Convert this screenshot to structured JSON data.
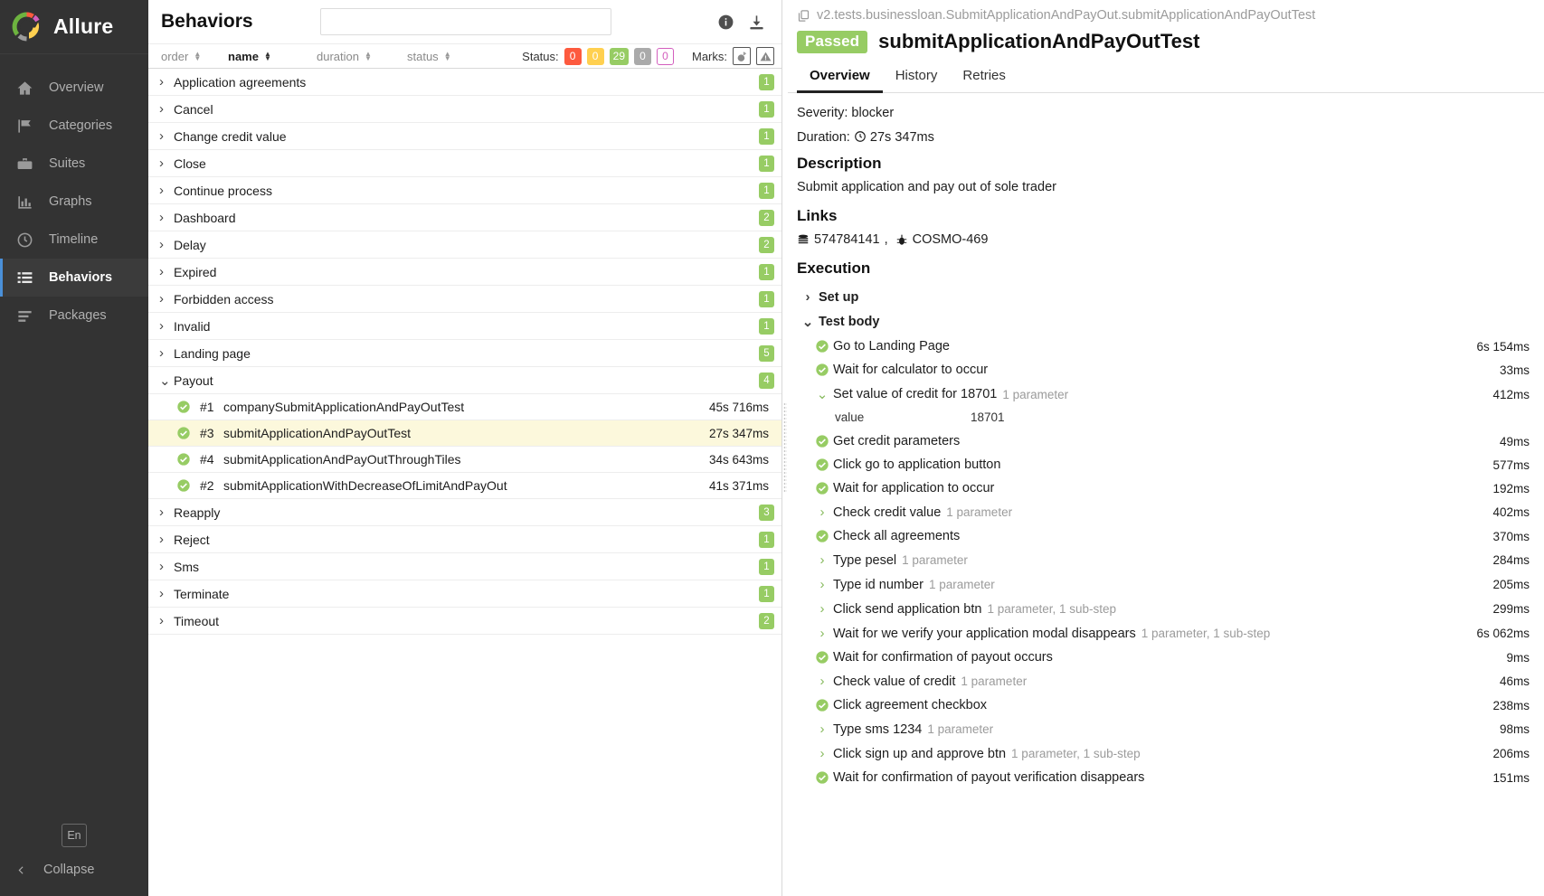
{
  "brand": {
    "name": "Allure",
    "logo_icon": "allure-logo-icon"
  },
  "sidebar": {
    "items": [
      {
        "label": "Overview",
        "icon": "home-icon",
        "active": false
      },
      {
        "label": "Categories",
        "icon": "flag-icon",
        "active": false
      },
      {
        "label": "Suites",
        "icon": "briefcase-icon",
        "active": false
      },
      {
        "label": "Graphs",
        "icon": "bar-chart-icon",
        "active": false
      },
      {
        "label": "Timeline",
        "icon": "clock-icon",
        "active": false
      },
      {
        "label": "Behaviors",
        "icon": "list-icon",
        "active": true
      },
      {
        "label": "Packages",
        "icon": "layers-icon",
        "active": false
      }
    ],
    "language_button": "En",
    "collapse_label": "Collapse",
    "collapse_icon": "chevron-left-icon"
  },
  "header": {
    "title": "Behaviors",
    "search_value": "",
    "search_placeholder": "",
    "info_icon": "info-icon",
    "download_icon": "download-icon"
  },
  "toolbar": {
    "columns": [
      {
        "label": "order",
        "active": false
      },
      {
        "label": "name",
        "active": true
      },
      {
        "label": "duration",
        "active": false
      },
      {
        "label": "status",
        "active": false
      }
    ],
    "status_label": "Status:",
    "status_counts": [
      {
        "key": "failed",
        "value": "0"
      },
      {
        "key": "broken",
        "value": "0"
      },
      {
        "key": "passed",
        "value": "29"
      },
      {
        "key": "skipped",
        "value": "0"
      },
      {
        "key": "unknown",
        "value": "0"
      }
    ],
    "marks_label": "Marks:",
    "marks": [
      {
        "icon": "bomb-icon"
      },
      {
        "icon": "warning-triangle-icon"
      }
    ]
  },
  "tree": {
    "rows": [
      {
        "type": "group",
        "label": "Application agreements",
        "expanded": false,
        "badge": "1"
      },
      {
        "type": "group",
        "label": "Cancel",
        "expanded": false,
        "badge": "1"
      },
      {
        "type": "group",
        "label": "Change credit value",
        "expanded": false,
        "badge": "1"
      },
      {
        "type": "group",
        "label": "Close",
        "expanded": false,
        "badge": "1"
      },
      {
        "type": "group",
        "label": "Continue process",
        "expanded": false,
        "badge": "1"
      },
      {
        "type": "group",
        "label": "Dashboard",
        "expanded": false,
        "badge": "2"
      },
      {
        "type": "group",
        "label": "Delay",
        "expanded": false,
        "badge": "2"
      },
      {
        "type": "group",
        "label": "Expired",
        "expanded": false,
        "badge": "1"
      },
      {
        "type": "group",
        "label": "Forbidden access",
        "expanded": false,
        "badge": "1"
      },
      {
        "type": "group",
        "label": "Invalid",
        "expanded": false,
        "badge": "1"
      },
      {
        "type": "group",
        "label": "Landing page",
        "expanded": false,
        "badge": "5"
      },
      {
        "type": "group",
        "label": "Payout",
        "expanded": true,
        "badge": "4"
      },
      {
        "type": "leaf",
        "num": "#1",
        "label": "companySubmitApplicationAndPayOutTest",
        "duration": "45s 716ms",
        "status": "passed",
        "active": false
      },
      {
        "type": "leaf",
        "num": "#3",
        "label": "submitApplicationAndPayOutTest",
        "duration": "27s 347ms",
        "status": "passed",
        "active": true
      },
      {
        "type": "leaf",
        "num": "#4",
        "label": "submitApplicationAndPayOutThroughTiles",
        "duration": "34s 643ms",
        "status": "passed",
        "active": false
      },
      {
        "type": "leaf",
        "num": "#2",
        "label": "submitApplicationWithDecreaseOfLimitAndPayOut",
        "duration": "41s 371ms",
        "status": "passed",
        "active": false
      },
      {
        "type": "group",
        "label": "Reapply",
        "expanded": false,
        "badge": "3"
      },
      {
        "type": "group",
        "label": "Reject",
        "expanded": false,
        "badge": "1"
      },
      {
        "type": "group",
        "label": "Sms",
        "expanded": false,
        "badge": "1"
      },
      {
        "type": "group",
        "label": "Terminate",
        "expanded": false,
        "badge": "1"
      },
      {
        "type": "group",
        "label": "Timeout",
        "expanded": false,
        "badge": "2"
      }
    ]
  },
  "detail": {
    "breadcrumb_icon": "copy-icon",
    "breadcrumb": "v2.tests.businessloan.SubmitApplicationAndPayOut.submitApplicationAndPayOutTest",
    "status_badge": "Passed",
    "title": "submitApplicationAndPayOutTest",
    "tabs": [
      {
        "label": "Overview",
        "active": true
      },
      {
        "label": "History",
        "active": false
      },
      {
        "label": "Retries",
        "active": false
      }
    ],
    "severity_line": "Severity: blocker",
    "duration_prefix": "Duration:",
    "duration_icon": "clock-icon",
    "duration_value": "27s 347ms",
    "description_heading": "Description",
    "description_text": "Submit application and pay out of sole trader",
    "links_heading": "Links",
    "links": [
      {
        "icon": "database-icon",
        "label": "574784141"
      },
      {
        "icon": "bug-icon",
        "label": "COSMO-469"
      }
    ],
    "links_separator": ",",
    "execution_heading": "Execution",
    "execution": [
      {
        "level": 0,
        "kind": "collapsed-group",
        "label": "Set up",
        "sub": "",
        "time": ""
      },
      {
        "level": 0,
        "kind": "expanded-group",
        "label": "Test body",
        "sub": "",
        "time": ""
      },
      {
        "level": 1,
        "kind": "ok",
        "label": "Go to Landing Page",
        "sub": "",
        "time": "6s 154ms"
      },
      {
        "level": 1,
        "kind": "ok",
        "label": "Wait for calculator to occur",
        "sub": "",
        "time": "33ms"
      },
      {
        "level": 1,
        "kind": "expanded",
        "label": "Set value of credit for 18701",
        "sub": "1 parameter",
        "time": "412ms"
      },
      {
        "level": 1,
        "kind": "param",
        "label": "value",
        "value": "18701",
        "sub": "",
        "time": ""
      },
      {
        "level": 1,
        "kind": "ok",
        "label": "Get credit parameters",
        "sub": "",
        "time": "49ms"
      },
      {
        "level": 1,
        "kind": "ok",
        "label": "Click go to application button",
        "sub": "",
        "time": "577ms"
      },
      {
        "level": 1,
        "kind": "ok",
        "label": "Wait for application to occur",
        "sub": "",
        "time": "192ms"
      },
      {
        "level": 1,
        "kind": "collapsed",
        "label": "Check credit value",
        "sub": "1 parameter",
        "time": "402ms"
      },
      {
        "level": 1,
        "kind": "ok",
        "label": "Check all agreements",
        "sub": "",
        "time": "370ms"
      },
      {
        "level": 1,
        "kind": "collapsed",
        "label": "Type pesel",
        "sub": "1 parameter",
        "time": "284ms"
      },
      {
        "level": 1,
        "kind": "collapsed",
        "label": "Type id number",
        "sub": "1 parameter",
        "time": "205ms"
      },
      {
        "level": 1,
        "kind": "collapsed",
        "label": "Click send application btn",
        "sub": "1 parameter, 1 sub-step",
        "time": "299ms"
      },
      {
        "level": 1,
        "kind": "collapsed",
        "label": "Wait for we verify your application modal disappears",
        "sub": "1 parameter, 1 sub-step",
        "time": "6s 062ms"
      },
      {
        "level": 1,
        "kind": "ok",
        "label": "Wait for confirmation of payout occurs",
        "sub": "",
        "time": "9ms"
      },
      {
        "level": 1,
        "kind": "collapsed",
        "label": "Check value of credit",
        "sub": "1 parameter",
        "time": "46ms"
      },
      {
        "level": 1,
        "kind": "ok",
        "label": "Click agreement checkbox",
        "sub": "",
        "time": "238ms"
      },
      {
        "level": 1,
        "kind": "collapsed",
        "label": "Type sms 1234",
        "sub": "1 parameter",
        "time": "98ms"
      },
      {
        "level": 1,
        "kind": "collapsed",
        "label": "Click sign up and approve btn",
        "sub": "1 parameter, 1 sub-step",
        "time": "206ms"
      },
      {
        "level": 1,
        "kind": "ok",
        "label": "Wait for confirmation of payout verification disappears",
        "sub": "",
        "time": "151ms"
      }
    ]
  },
  "colors": {
    "passed": "#97cc64",
    "failed": "#fd5a3e",
    "broken": "#ffd050",
    "skipped": "#aaaaaa",
    "unknown": "#d35ebe",
    "sidebar_bg": "#333333",
    "selected_row": "#fcf8dc"
  }
}
